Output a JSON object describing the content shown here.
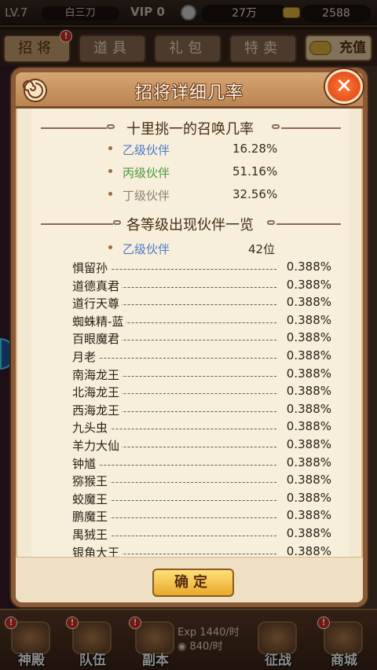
{
  "topbar": {
    "level": "LV.7",
    "player_name": "白三刀",
    "vip": "VIP 0",
    "coins": "27万",
    "gold": "2588"
  },
  "tabs": [
    {
      "label": "招将",
      "active": true,
      "badge": "!"
    },
    {
      "label": "道具",
      "active": false
    },
    {
      "label": "礼包",
      "active": false
    },
    {
      "label": "特卖",
      "active": false
    }
  ],
  "recharge_label": "充值",
  "dialog": {
    "title": "招将详细几率",
    "close_label": "✕",
    "section1_title": "十里挑一的召唤几率",
    "rates": [
      {
        "name": "乙级伙伴",
        "value": "16.28%",
        "color": "#4a7ac6"
      },
      {
        "name": "丙级伙伴",
        "value": "51.16%",
        "color": "#4a9a3a"
      },
      {
        "name": "丁级伙伴",
        "value": "32.56%",
        "color": "#8a8078"
      }
    ],
    "section2_title": "各等级出现伙伴一览",
    "grade": {
      "name": "乙级伙伴",
      "count": "42位"
    },
    "partners": [
      {
        "name": "惧留孙",
        "rate": "0.388%"
      },
      {
        "name": "道德真君",
        "rate": "0.388%"
      },
      {
        "name": "道行天尊",
        "rate": "0.388%"
      },
      {
        "name": "蜘蛛精-蓝",
        "rate": "0.388%"
      },
      {
        "name": "百眼魔君",
        "rate": "0.388%"
      },
      {
        "name": "月老",
        "rate": "0.388%"
      },
      {
        "name": "南海龙王",
        "rate": "0.388%"
      },
      {
        "name": "北海龙王",
        "rate": "0.388%"
      },
      {
        "name": "西海龙王",
        "rate": "0.388%"
      },
      {
        "name": "九头虫",
        "rate": "0.388%"
      },
      {
        "name": "羊力大仙",
        "rate": "0.388%"
      },
      {
        "name": "钟馗",
        "rate": "0.388%"
      },
      {
        "name": "猕猴王",
        "rate": "0.388%"
      },
      {
        "name": "蛟魔王",
        "rate": "0.388%"
      },
      {
        "name": "鹏魔王",
        "rate": "0.388%"
      },
      {
        "name": "禺狨王",
        "rate": "0.388%"
      },
      {
        "name": "银角大王",
        "rate": "0.388%"
      }
    ],
    "confirm_label": "确定"
  },
  "bottom_nav": [
    {
      "label": "神殿",
      "icon": "temple-icon",
      "badge": "!"
    },
    {
      "label": "队伍",
      "icon": "team-icon",
      "badge": "!"
    },
    {
      "label": "副本",
      "icon": "scroll-icon",
      "badge": "!"
    },
    {
      "label": "征战",
      "icon": "crossed-swords-icon"
    },
    {
      "label": "商城",
      "icon": "treasure-chest-icon",
      "badge": "!"
    }
  ],
  "exp_rate": "1440/时",
  "coin_rate": "840/时"
}
